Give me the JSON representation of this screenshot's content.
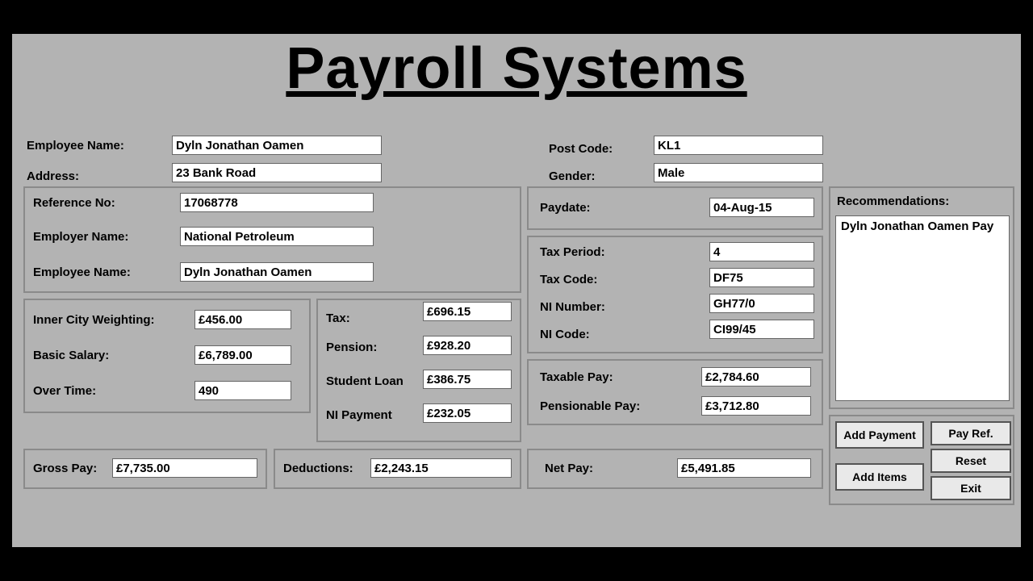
{
  "title": "Payroll Systems",
  "labels": {
    "employee_name": "Employee Name:",
    "address": "Address:",
    "post_code": "Post Code:",
    "gender": "Gender:",
    "reference_no": "Reference No:",
    "employer_name": "Employer Name:",
    "employee_name2": "Employee Name:",
    "paydate": "Paydate:",
    "tax_period": "Tax Period:",
    "tax_code": "Tax Code:",
    "ni_number": "NI Number:",
    "ni_code": "NI Code:",
    "inner_city": "Inner City Weighting:",
    "basic_salary": "Basic Salary:",
    "over_time": "Over Time:",
    "tax": "Tax:",
    "pension": "Pension:",
    "student_loan": "Student Loan",
    "ni_payment": "NI Payment",
    "taxable_pay": "Taxable Pay:",
    "pensionable_pay": "Pensionable Pay:",
    "gross_pay": "Gross Pay:",
    "deductions": "Deductions:",
    "net_pay": "Net Pay:",
    "recommendations": "Recommendations:"
  },
  "values": {
    "employee_name": "Dyln Jonathan Oamen",
    "address": "23 Bank Road",
    "post_code": "KL1",
    "gender": "Male",
    "reference_no": "17068778",
    "employer_name": "National Petroleum",
    "employee_name2": "Dyln Jonathan Oamen",
    "paydate": "04-Aug-15",
    "tax_period": "4",
    "tax_code": "DF75",
    "ni_number": "GH77/0",
    "ni_code": "CI99/45",
    "inner_city": "£456.00",
    "basic_salary": "£6,789.00",
    "over_time": "490",
    "tax": "£696.15",
    "pension": "£928.20",
    "student_loan": "£386.75",
    "ni_payment": "£232.05",
    "taxable_pay": "£2,784.60",
    "pensionable_pay": "£3,712.80",
    "gross_pay": "£7,735.00",
    "deductions": "£2,243.15",
    "net_pay": "£5,491.85",
    "recommendations": "Dyln Jonathan Oamen Pay"
  },
  "buttons": {
    "add_payment": "Add Payment",
    "pay_ref": "Pay Ref.",
    "add_items": "Add Items",
    "reset": "Reset",
    "exit": "Exit"
  }
}
